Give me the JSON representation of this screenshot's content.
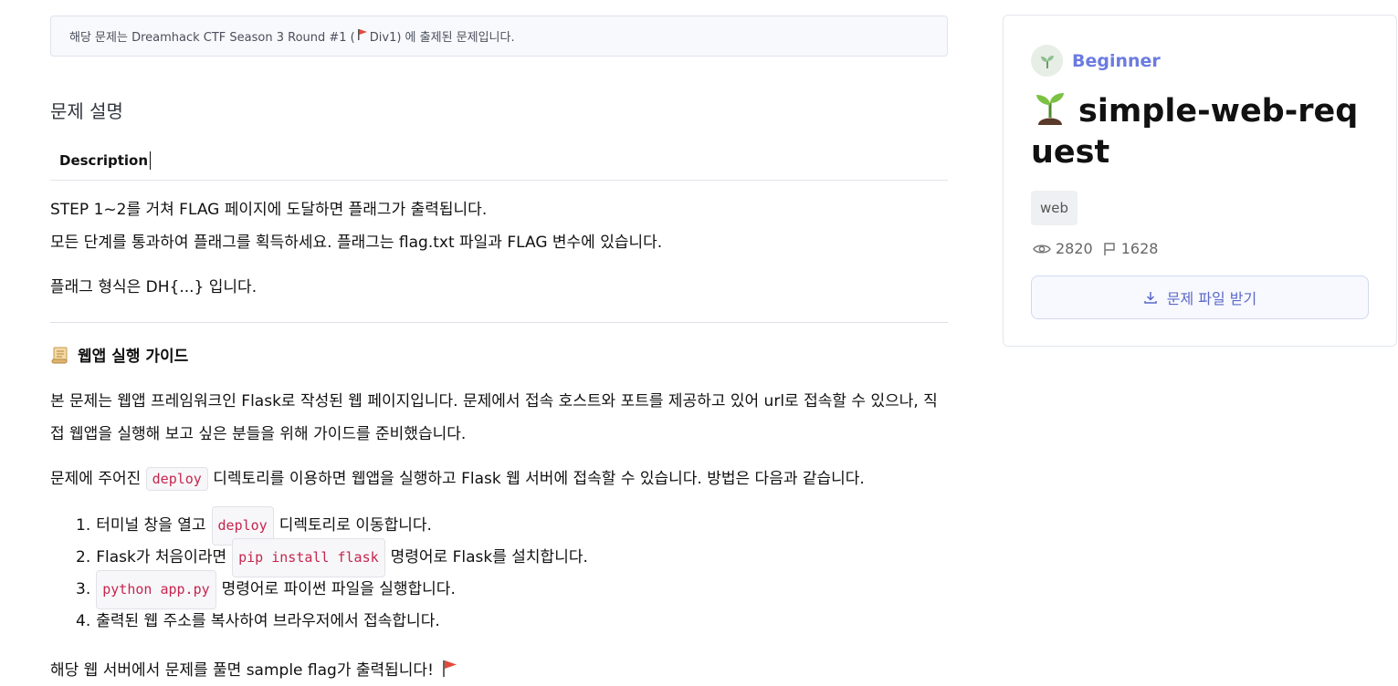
{
  "notice": {
    "before": "해당 문제는 Dreamhack CTF Season 3 Round #1 (",
    "flag_icon": "red-flag-icon",
    "after": " Div1) 에 출제된 문제입니다."
  },
  "section_title": "문제 설명",
  "tab_label": "Description",
  "desc": {
    "line1": "STEP 1~2를 거쳐 FLAG 페이지에 도달하면 플래그가 출력됩니다.",
    "line2": "모든 단계를 통과하여 플래그를 획득하세요. 플래그는 flag.txt 파일과 FLAG 변수에 있습니다.",
    "line3": "플래그 형식은 DH{...} 입니다."
  },
  "guide": {
    "icon": "scroll-icon",
    "title": "웹앱 실행 가이드",
    "para1": "본 문제는 웹앱 프레임워크인 Flask로 작성된 웹 페이지입니다. 문제에서 접속 호스트와 포트를 제공하고 있어 url로 접속할 수 있으나, 직접 웹앱을 실행해 보고 싶은 분들을 위해 가이드를 준비했습니다.",
    "para2_before": "문제에 주어진 ",
    "para2_code": "deploy",
    "para2_after": " 디렉토리를 이용하면 웹앱을 실행하고 Flask 웹 서버에 접속할 수 있습니다. 방법은 다음과 같습니다.",
    "steps": [
      {
        "num": "1.",
        "before": "터미널 창을 열고",
        "code": "deploy",
        "after": "디렉토리로 이동합니다."
      },
      {
        "num": "2.",
        "before": "Flask가 처음이라면",
        "code": "pip install flask",
        "after": "명령어로 Flask를 설치합니다."
      },
      {
        "num": "3.",
        "before": "",
        "code": "python app.py",
        "after": "명령어로 파이썬 파일을 실행합니다."
      },
      {
        "num": "4.",
        "before": "출력된 웹 주소를 복사하여 브라우저에서 접속합니다.",
        "code": "",
        "after": ""
      }
    ],
    "closing": "해당 웹 서버에서 문제를 풀면 sample flag가 출력됩니다!"
  },
  "card": {
    "level_icon": "sprout-icon",
    "level": "Beginner",
    "title": "simple-web-request",
    "tag": "web",
    "views": "2820",
    "solves": "1628",
    "download_label": "문제 파일 받기",
    "colors": {
      "accent": "#6b7be0",
      "flag": "#e24a3b"
    }
  }
}
